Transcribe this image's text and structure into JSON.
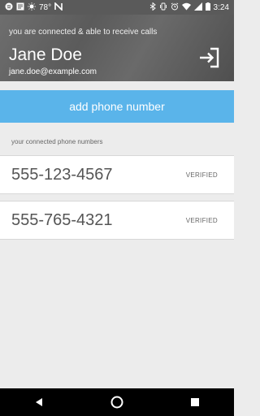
{
  "status_bar": {
    "temperature": "78°",
    "time": "3:24",
    "icons_left": [
      "spotify-icon",
      "mail-icon",
      "temperature-icon",
      "n-icon"
    ],
    "icons_right": [
      "bluetooth-icon",
      "vibrate-icon",
      "alarm-icon",
      "wifi-icon",
      "signal-icon",
      "battery-icon"
    ]
  },
  "header": {
    "subtitle": "you are connected & able to receive calls",
    "name": "Jane Doe",
    "email": "jane.doe@example.com",
    "logout_icon": "logout-icon"
  },
  "main": {
    "add_button_label": "add phone number",
    "section_title": "your connected phone numbers",
    "phones": [
      {
        "number": "555-123-4567",
        "status": "VERIFIED"
      },
      {
        "number": "555-765-4321",
        "status": "VERIFIED"
      }
    ]
  },
  "nav": {
    "icons": [
      "back-icon",
      "home-icon",
      "recents-icon"
    ]
  },
  "colors": {
    "accent": "#5ab4ea",
    "header_bg": "#5f5f5f",
    "background": "#ececec"
  }
}
